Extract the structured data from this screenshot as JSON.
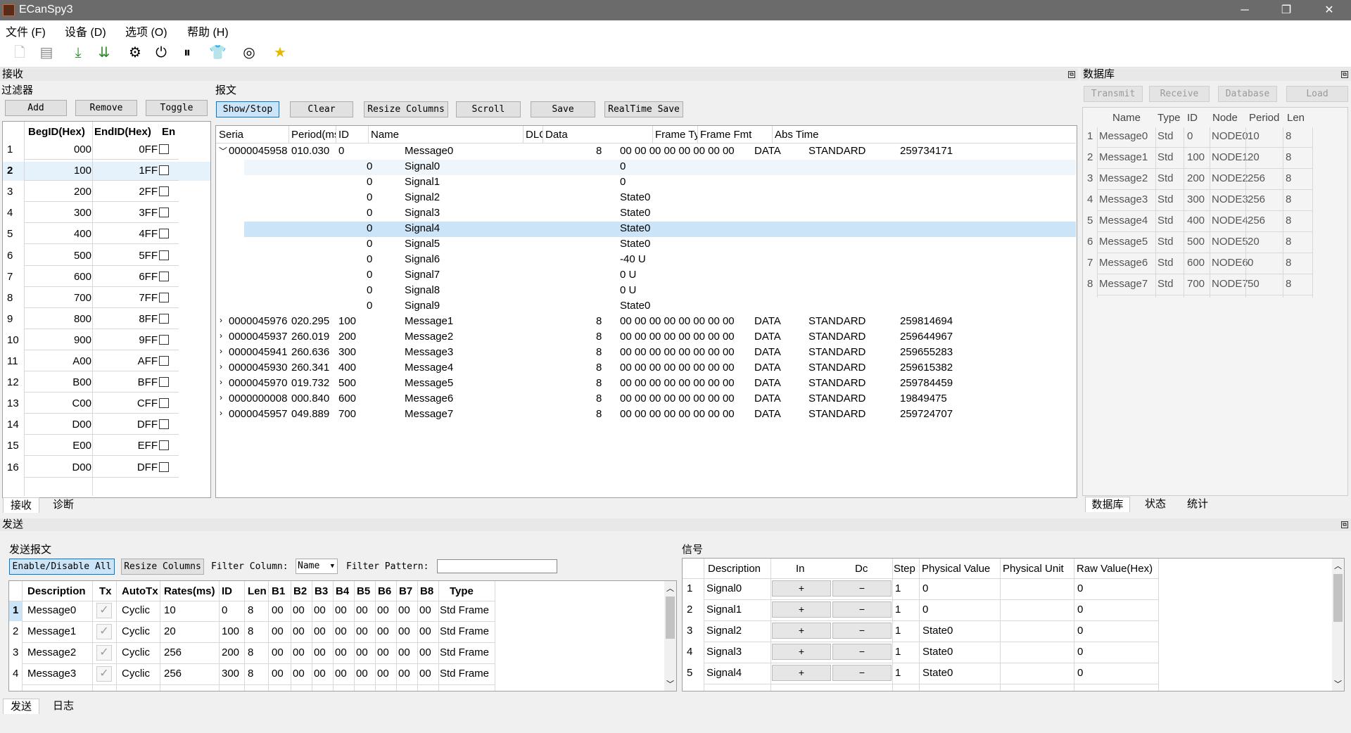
{
  "window": {
    "title": "ECanSpy3",
    "minimize": "─",
    "restore": "❐",
    "close": "✕"
  },
  "menu": [
    "文件 (F)",
    "设备 (D)",
    "选项 (O)",
    "帮助 (H)"
  ],
  "toolbar_icons": [
    "new-icon",
    "open-icon",
    "download-icon",
    "download-all-icon",
    "gear-icon",
    "power-icon",
    "pause-icon",
    "shirt-icon",
    "refresh-icon",
    "star-icon"
  ],
  "receive": {
    "panel_title": "接收",
    "filter": {
      "title": "过滤器",
      "buttons": [
        "Add",
        "Remove",
        "Toggle"
      ],
      "headers": [
        "BegID(Hex)",
        "EndID(Hex)",
        "En"
      ],
      "rows": [
        [
          "1",
          "000",
          "0FF"
        ],
        [
          "2",
          "100",
          "1FF"
        ],
        [
          "3",
          "200",
          "2FF"
        ],
        [
          "4",
          "300",
          "3FF"
        ],
        [
          "5",
          "400",
          "4FF"
        ],
        [
          "6",
          "500",
          "5FF"
        ],
        [
          "7",
          "600",
          "6FF"
        ],
        [
          "8",
          "700",
          "7FF"
        ],
        [
          "9",
          "800",
          "8FF"
        ],
        [
          "10",
          "900",
          "9FF"
        ],
        [
          "11",
          "A00",
          "AFF"
        ],
        [
          "12",
          "B00",
          "BFF"
        ],
        [
          "13",
          "C00",
          "CFF"
        ],
        [
          "14",
          "D00",
          "DFF"
        ],
        [
          "15",
          "E00",
          "EFF"
        ],
        [
          "16",
          "D00",
          "DFF"
        ]
      ]
    },
    "messages": {
      "title": "报文",
      "buttons": [
        "Show/Stop",
        "Clear",
        "Resize Columns",
        "Scroll",
        "Save",
        "RealTime Save"
      ],
      "headers": [
        "Seria",
        "Period(ms",
        "ID",
        "Name",
        "DLC",
        "Data",
        "Frame Ty|",
        "Frame Fmt",
        "Abs Time"
      ],
      "expanded": {
        "serial": "0000045958",
        "period": "010.030",
        "id": "0",
        "name": "Message0",
        "dlc": "8",
        "data": "00 00 00 00 00 00 00 00",
        "type": "DATA",
        "fmt": "STANDARD",
        "time": "259734171"
      },
      "signals": [
        [
          "0",
          "Signal0",
          "0"
        ],
        [
          "0",
          "Signal1",
          "0"
        ],
        [
          "0",
          "Signal2",
          "State0"
        ],
        [
          "0",
          "Signal3",
          "State0"
        ],
        [
          "0",
          "Signal4",
          "State0"
        ],
        [
          "0",
          "Signal5",
          "State0"
        ],
        [
          "0",
          "Signal6",
          "-40 U"
        ],
        [
          "0",
          "Signal7",
          "0 U"
        ],
        [
          "0",
          "Signal8",
          "0 U"
        ],
        [
          "0",
          "Signal9",
          "State0"
        ]
      ],
      "rows": [
        [
          "0000045976",
          "020.295",
          "100",
          "Message1",
          "8",
          "00 00 00 00 00 00 00 00",
          "DATA",
          "STANDARD",
          "259814694"
        ],
        [
          "0000045937",
          "260.019",
          "200",
          "Message2",
          "8",
          "00 00 00 00 00 00 00 00",
          "DATA",
          "STANDARD",
          "259644967"
        ],
        [
          "0000045941",
          "260.636",
          "300",
          "Message3",
          "8",
          "00 00 00 00 00 00 00 00",
          "DATA",
          "STANDARD",
          "259655283"
        ],
        [
          "0000045930",
          "260.341",
          "400",
          "Message4",
          "8",
          "00 00 00 00 00 00 00 00",
          "DATA",
          "STANDARD",
          "259615382"
        ],
        [
          "0000045970",
          "019.732",
          "500",
          "Message5",
          "8",
          "00 00 00 00 00 00 00 00",
          "DATA",
          "STANDARD",
          "259784459"
        ],
        [
          "0000000008",
          "000.840",
          "600",
          "Message6",
          "8",
          "00 00 00 00 00 00 00 00",
          "DATA",
          "STANDARD",
          "19849475"
        ],
        [
          "0000045957",
          "049.889",
          "700",
          "Message7",
          "8",
          "00 00 00 00 00 00 00 00",
          "DATA",
          "STANDARD",
          "259724707"
        ]
      ]
    },
    "tabs": [
      "接收",
      "诊断"
    ]
  },
  "database": {
    "panel_title": "数据库",
    "buttons": [
      "Transmit",
      "Receive",
      "Database",
      "Load DBC..."
    ],
    "headers": [
      "Name",
      "Type",
      "ID",
      "Node",
      "Period",
      "Len"
    ],
    "rows": [
      [
        "1",
        "Message0",
        "Std",
        "0",
        "NODE0",
        "10",
        "8"
      ],
      [
        "2",
        "Message1",
        "Std",
        "100",
        "NODE1",
        "20",
        "8"
      ],
      [
        "3",
        "Message2",
        "Std",
        "200",
        "NODE2",
        "256",
        "8"
      ],
      [
        "4",
        "Message3",
        "Std",
        "300",
        "NODE3",
        "256",
        "8"
      ],
      [
        "5",
        "Message4",
        "Std",
        "400",
        "NODE4",
        "256",
        "8"
      ],
      [
        "6",
        "Message5",
        "Std",
        "500",
        "NODE5",
        "20",
        "8"
      ],
      [
        "7",
        "Message6",
        "Std",
        "600",
        "NODE6",
        "0",
        "8"
      ],
      [
        "8",
        "Message7",
        "Std",
        "700",
        "NODE7",
        "50",
        "8"
      ]
    ],
    "tabs": [
      "数据库",
      "状态",
      "统计"
    ]
  },
  "send": {
    "panel_title": "发送",
    "messages_title": "发送报文",
    "buttons": [
      "Enable/Disable All",
      "Resize Columns"
    ],
    "filter_column_label": "Filter Column:",
    "filter_column_value": "Name",
    "filter_pattern_label": "Filter Pattern:",
    "headers": [
      "Description",
      "Tx",
      "AutoTx",
      "Rates(ms)",
      "ID",
      "Len",
      "B1",
      "B2",
      "B3",
      "B4",
      "B5",
      "B6",
      "B7",
      "B8",
      "Type"
    ],
    "rows": [
      [
        "1",
        "Message0",
        "Cyclic",
        "10",
        "0",
        "8",
        "00",
        "00",
        "00",
        "00",
        "00",
        "00",
        "00",
        "00",
        "Std Frame"
      ],
      [
        "2",
        "Message1",
        "Cyclic",
        "20",
        "100",
        "8",
        "00",
        "00",
        "00",
        "00",
        "00",
        "00",
        "00",
        "00",
        "Std Frame"
      ],
      [
        "3",
        "Message2",
        "Cyclic",
        "256",
        "200",
        "8",
        "00",
        "00",
        "00",
        "00",
        "00",
        "00",
        "00",
        "00",
        "Std Frame"
      ],
      [
        "4",
        "Message3",
        "Cyclic",
        "256",
        "300",
        "8",
        "00",
        "00",
        "00",
        "00",
        "00",
        "00",
        "00",
        "00",
        "Std Frame"
      ]
    ],
    "signals": {
      "title": "信号",
      "headers": [
        "Description",
        "In",
        "Dc",
        "Step",
        "Physical Value",
        "Physical Unit",
        "Raw Value(Hex)"
      ],
      "inc": "+",
      "dec": "−",
      "rows": [
        [
          "1",
          "Signal0",
          "1",
          "0",
          "",
          "0"
        ],
        [
          "2",
          "Signal1",
          "1",
          "0",
          "",
          "0"
        ],
        [
          "3",
          "Signal2",
          "1",
          "State0",
          "",
          "0"
        ],
        [
          "4",
          "Signal3",
          "1",
          "State0",
          "",
          "0"
        ],
        [
          "5",
          "Signal4",
          "1",
          "State0",
          "",
          "0"
        ]
      ]
    },
    "tabs": [
      "发送",
      "日志"
    ]
  }
}
